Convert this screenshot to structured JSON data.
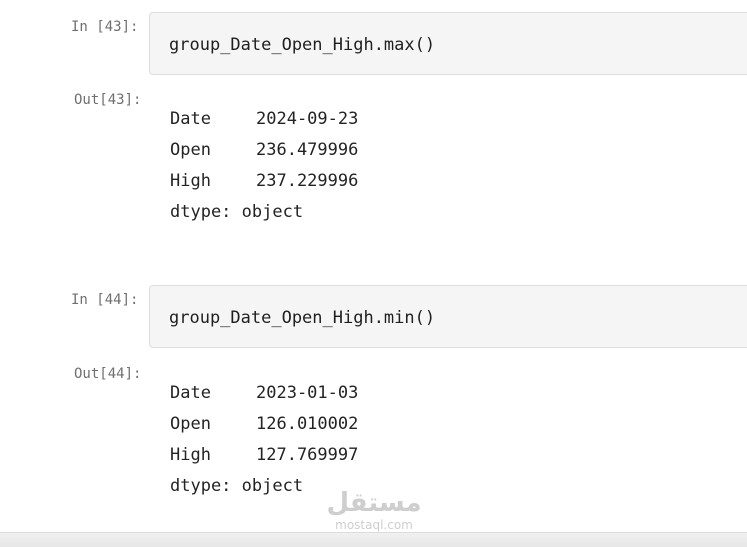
{
  "cells": [
    {
      "in_prompt": "In [43]:",
      "code": "group_Date_Open_High.max()",
      "out_prompt": "Out[43]:",
      "output": [
        {
          "key": "Date",
          "value": "2024-09-23"
        },
        {
          "key": "Open",
          "value": "236.479996"
        },
        {
          "key": "High",
          "value": "237.229996"
        }
      ],
      "dtype": "dtype: object"
    },
    {
      "in_prompt": "In [44]:",
      "code": "group_Date_Open_High.min()",
      "out_prompt": "Out[44]:",
      "output": [
        {
          "key": "Date",
          "value": "2023-01-03"
        },
        {
          "key": "Open",
          "value": "126.010002"
        },
        {
          "key": "High",
          "value": "127.769997"
        }
      ],
      "dtype": "dtype: object"
    }
  ],
  "watermark": {
    "arabic": "مستقل",
    "latin": "mostaql.com"
  }
}
